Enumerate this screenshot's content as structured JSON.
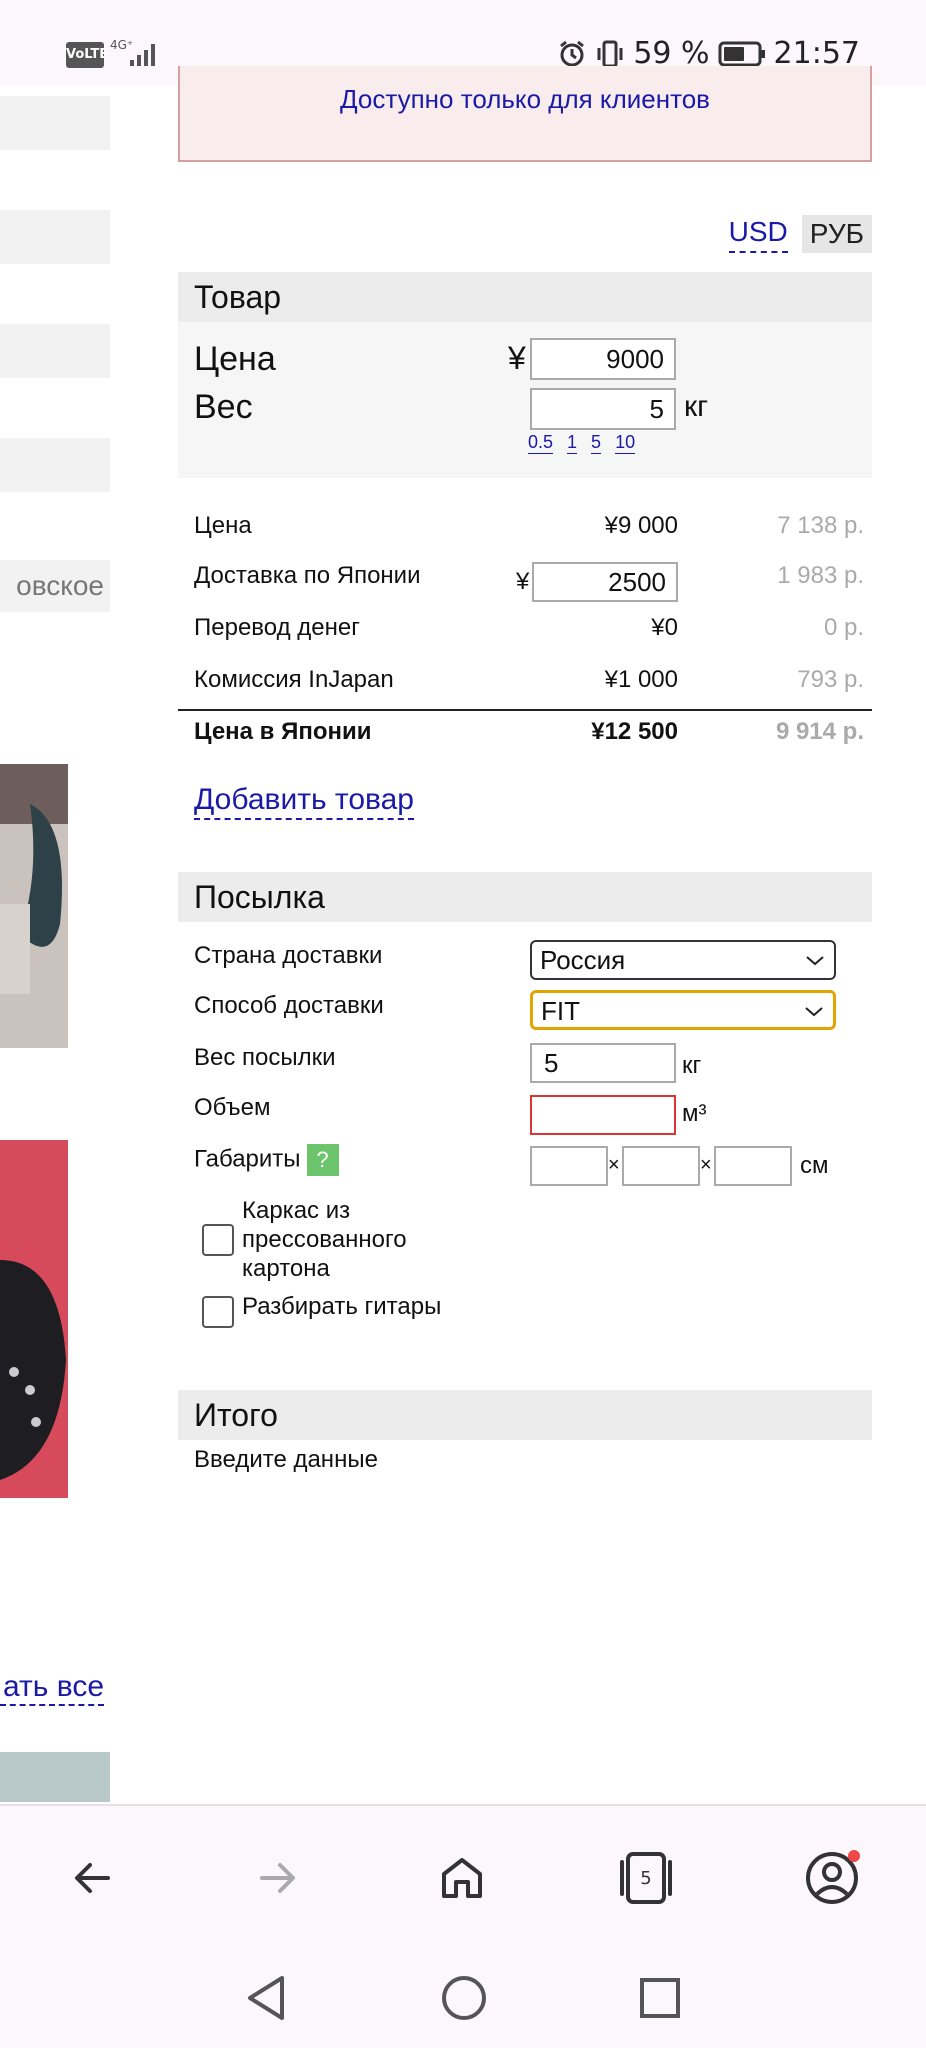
{
  "status_bar": {
    "volte": "VoLTE",
    "network": "4G⁺",
    "battery_percent": "59 %",
    "time": "21:57"
  },
  "left_partial": {
    "text_fragment": "овское",
    "link_fragment": "ать все"
  },
  "alert": {
    "text": "Доступно только для клиентов"
  },
  "currency": {
    "usd": "USD",
    "rub": "РУБ"
  },
  "goods": {
    "heading": "Товар",
    "price_label": "Цена",
    "price_currency": "¥",
    "price_value": "9000",
    "weight_label": "Вес",
    "weight_value": "5",
    "weight_unit": "кг",
    "quick_weights": [
      "0.5",
      "1",
      "5",
      "10"
    ]
  },
  "breakdown": {
    "rows": [
      {
        "label": "Цена",
        "value": "¥9 000",
        "rub": "7 138 р."
      },
      {
        "label": "Доставка по Японии",
        "currency": "¥",
        "value": "2500",
        "rub": "1 983 р."
      },
      {
        "label": "Перевод денег",
        "value": "¥0",
        "rub": "0 р."
      },
      {
        "label": "Комиссия InJapan",
        "value": "¥1 000",
        "rub": "793 р."
      }
    ],
    "total": {
      "label": "Цена в Японии",
      "value": "¥12 500",
      "rub": "9 914 р."
    }
  },
  "add_goods_link": "Добавить товар",
  "parcel": {
    "heading": "Посылка",
    "country_label": "Страна доставки",
    "country_value": "Россия",
    "method_label": "Способ доставки",
    "method_value": "FIT",
    "weight_label": "Вес посылки",
    "weight_value": "5",
    "weight_unit": "кг",
    "volume_label": "Объем",
    "volume_value": "",
    "volume_unit": "м³",
    "dims_label": "Габариты",
    "dims_help": "?",
    "dims_sep": "×",
    "dims_unit": "см",
    "cardboard_label_line1": "Каркас из",
    "cardboard_label_line2": "прессованного",
    "cardboard_label_line3": "картона",
    "guitars_label": "Разбирать гитары"
  },
  "total_section": {
    "heading": "Итого",
    "text": "Введите данные"
  },
  "browser": {
    "tab_count": "5"
  }
}
